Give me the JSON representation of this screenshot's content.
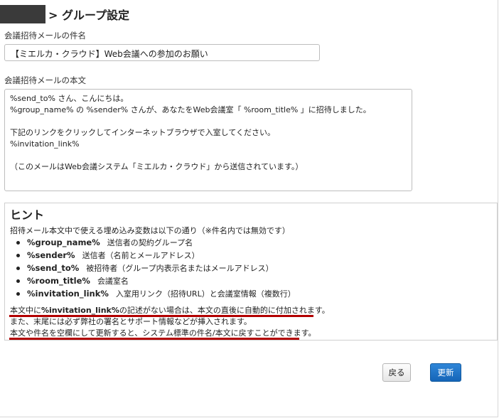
{
  "header": {
    "title": "> グループ設定"
  },
  "subject_field": {
    "label": "会議招待メールの件名",
    "value": "【ミエルカ・クラウド】Web会議への参加のお願い"
  },
  "body_field": {
    "label": "会議招待メールの本文",
    "lines": [
      "%send_to% さん、こんにちは。",
      "%group_name% の %sender% さんが、あなたをWeb会議室「 %room_title% 」に招待しました。",
      "",
      "下記のリンクをクリックしてインターネットブラウザで入室してください。",
      "%invitation_link%",
      "",
      "（このメールはWeb会議システム「ミエルカ・クラウド」から送信されています。）"
    ]
  },
  "hint": {
    "title": "ヒント",
    "intro": "招待メール本文中で使える埋め込み変数は以下の通り（※件名内では無効です）",
    "variables": [
      {
        "name": "%group_name%",
        "desc": "送信者の契約グループ名"
      },
      {
        "name": "%sender%",
        "desc": "送信者（名前とメールアドレス）"
      },
      {
        "name": "%send_to%",
        "desc": "被招待者（グループ内表示名またはメールアドレス）"
      },
      {
        "name": "%room_title%",
        "desc": "会議室名"
      },
      {
        "name": "%invitation_link%",
        "desc": "入室用リンク（招待URL）と会議室情報（複数行）"
      }
    ],
    "note1_prefix": "本文中に",
    "note1_bold": "%invitation_link%",
    "note1_suffix": "の記述がない場合は、本文の直後に自動的に付加されます。",
    "note2": "また、末尾には必ず弊社の署名とサポート情報などが挿入されます。",
    "note3": "本文や件名を空欄にして更新すると、システム標準の件名/本文に戻すことができます。"
  },
  "buttons": {
    "back": "戻る",
    "update": "更新"
  },
  "colors": {
    "accent_blue": "#1a6fc4",
    "underline_red": "#b20000"
  }
}
